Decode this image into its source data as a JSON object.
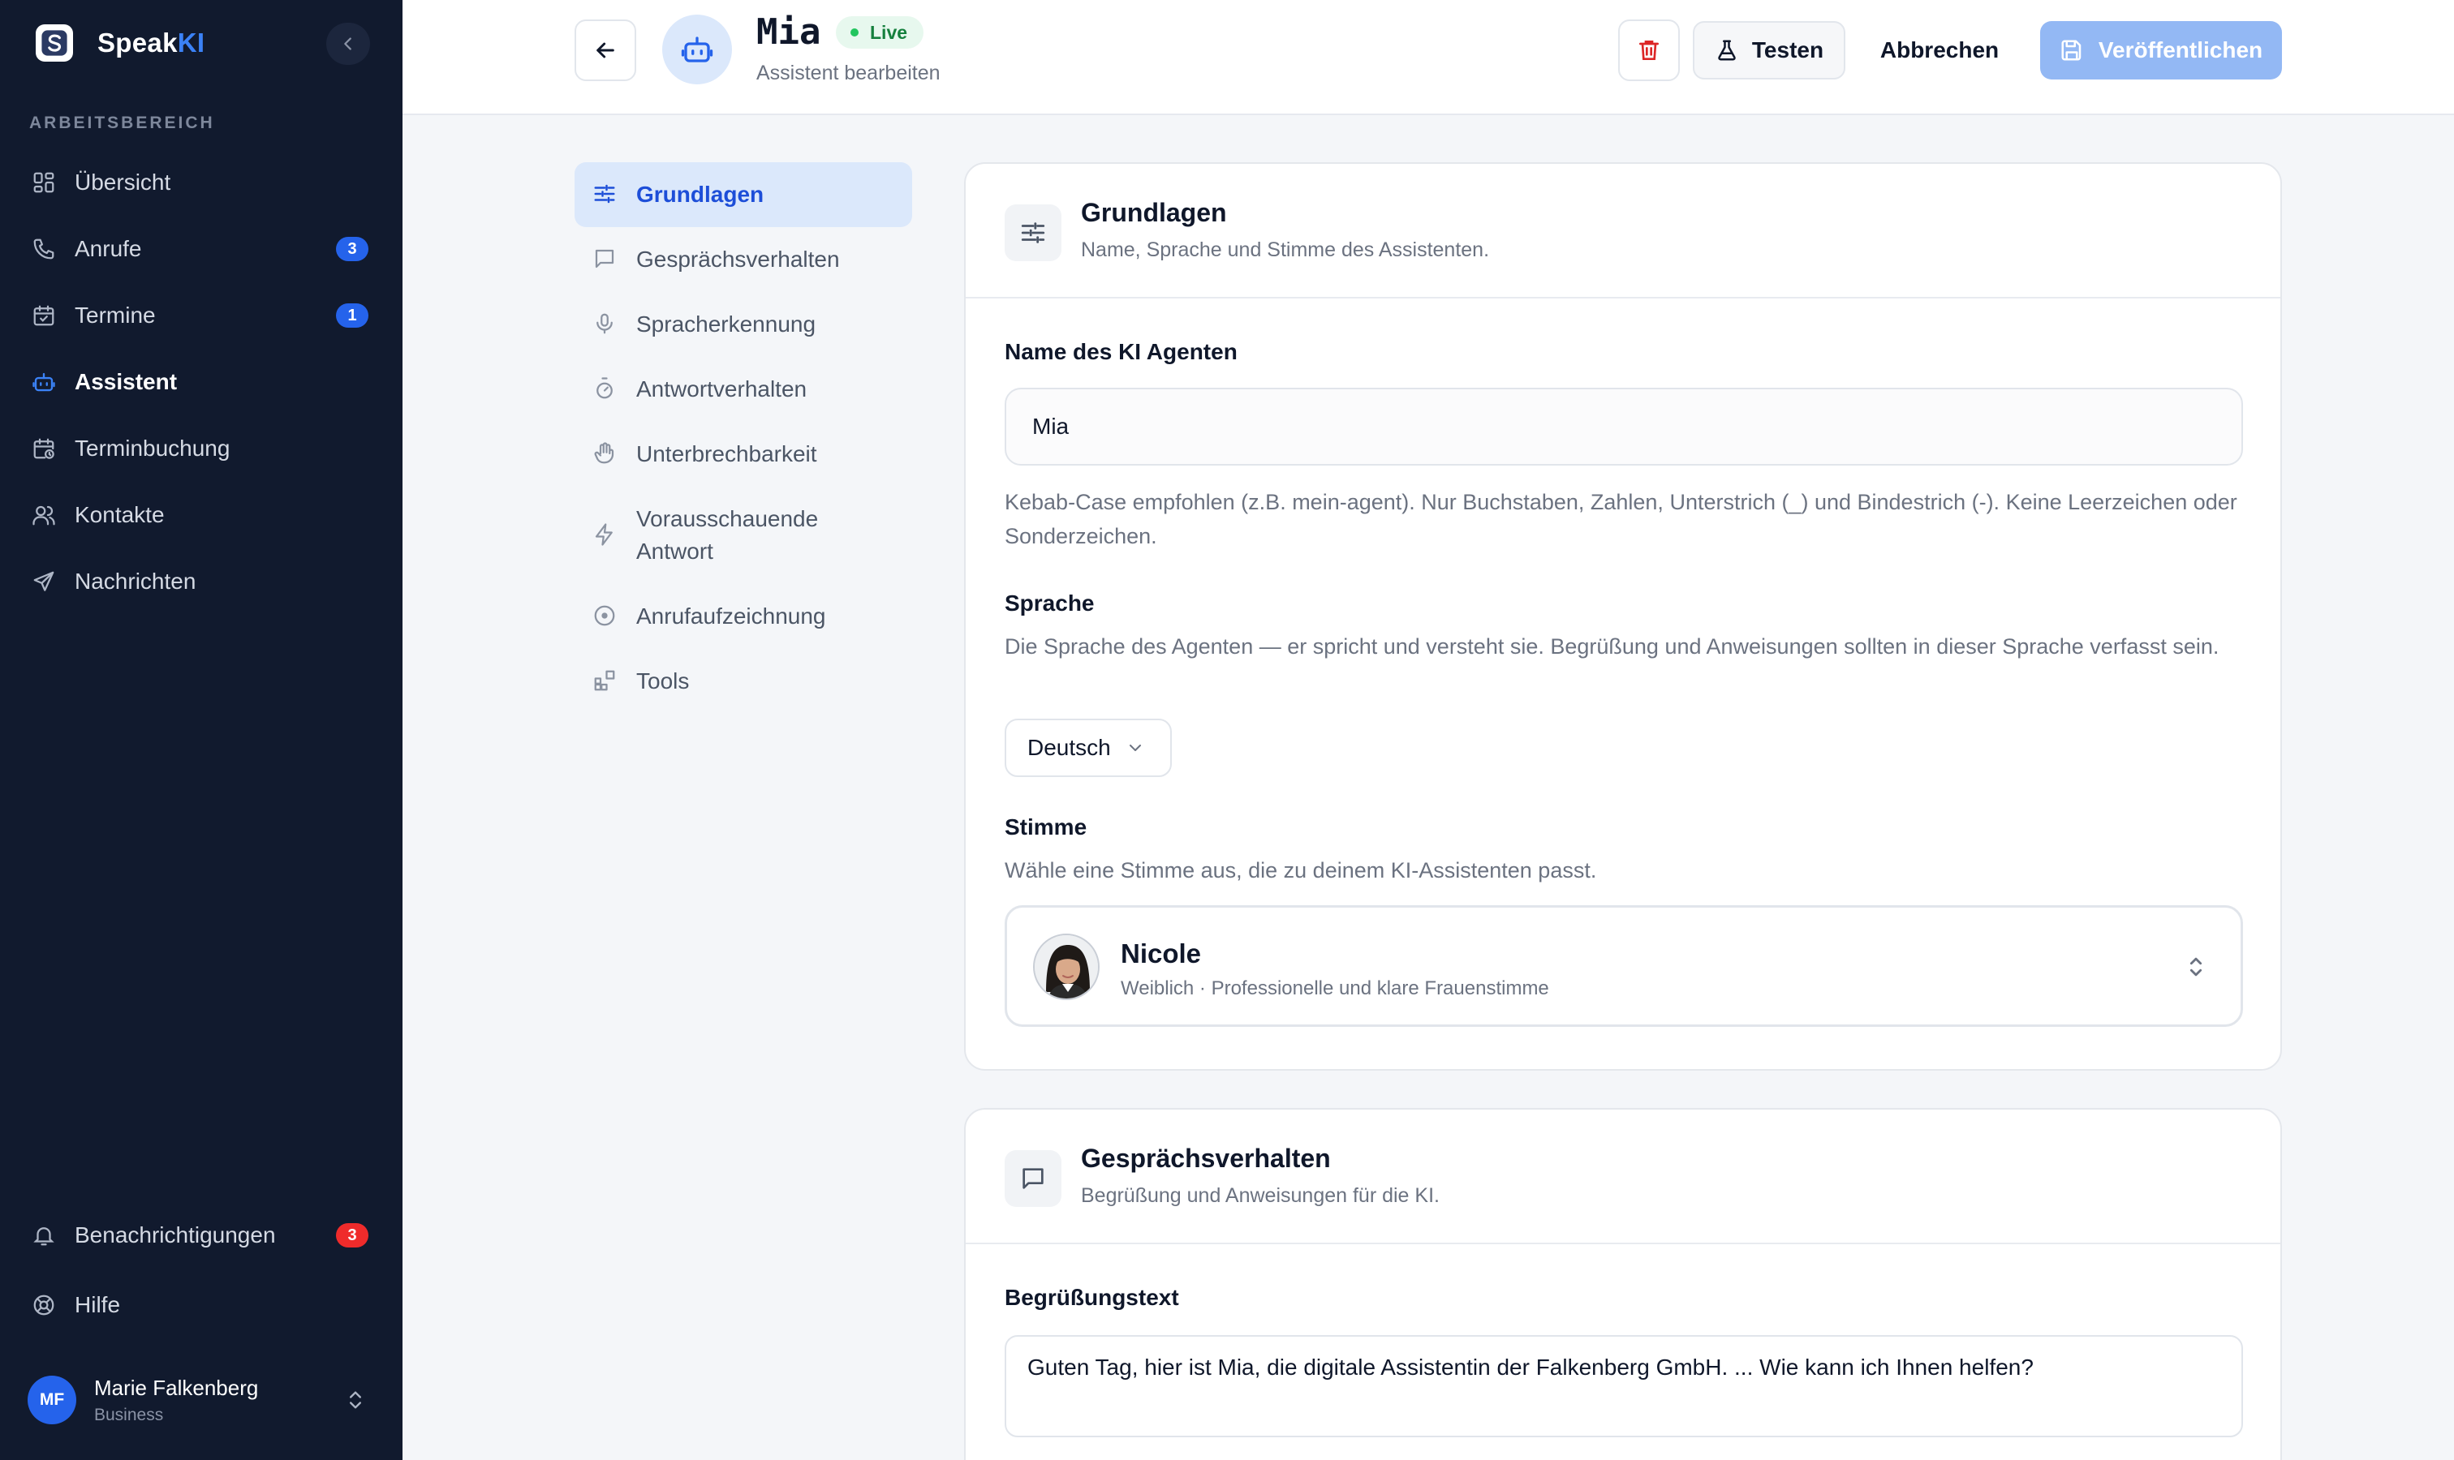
{
  "app": {
    "brand_prefix": "Speak",
    "brand_suffix": "KI"
  },
  "sidebar": {
    "section_label": "ARBEITSBEREICH",
    "items": [
      {
        "label": "Übersicht",
        "icon": "layout-grid-icon"
      },
      {
        "label": "Anrufe",
        "icon": "phone-icon",
        "badge": "3"
      },
      {
        "label": "Termine",
        "icon": "calendar-check-icon",
        "badge": "1"
      },
      {
        "label": "Assistent",
        "icon": "bot-icon",
        "active": true
      },
      {
        "label": "Terminbuchung",
        "icon": "calendar-clock-icon"
      },
      {
        "label": "Kontakte",
        "icon": "users-icon"
      },
      {
        "label": "Nachrichten",
        "icon": "send-icon"
      }
    ],
    "bottom_items": [
      {
        "label": "Benachrichtigungen",
        "icon": "bell-icon",
        "badge": "3"
      },
      {
        "label": "Hilfe",
        "icon": "life-buoy-icon"
      }
    ],
    "user": {
      "initials": "MF",
      "name": "Marie Falkenberg",
      "plan": "Business"
    }
  },
  "header": {
    "assistant_name": "Mia",
    "status": "Live",
    "subtitle": "Assistent bearbeiten",
    "test_label": "Testen",
    "cancel_label": "Abbrechen",
    "publish_label": "Veröffentlichen"
  },
  "subnav": {
    "items": [
      {
        "label": "Grundlagen",
        "icon": "sliders-icon",
        "active": true
      },
      {
        "label": "Gesprächsverhalten",
        "icon": "message-square-icon"
      },
      {
        "label": "Spracherkennung",
        "icon": "mic-icon"
      },
      {
        "label": "Antwortverhalten",
        "icon": "timer-icon"
      },
      {
        "label": "Unterbrechbarkeit",
        "icon": "hand-icon"
      },
      {
        "label": "Vorausschauende Antwort",
        "icon": "zap-icon"
      },
      {
        "label": "Anrufaufzeichnung",
        "icon": "record-icon"
      },
      {
        "label": "Tools",
        "icon": "blocks-icon"
      }
    ]
  },
  "basics": {
    "title": "Grundlagen",
    "subtitle": "Name, Sprache und Stimme des Assistenten.",
    "name_label": "Name des KI Agenten",
    "name_value": "Mia",
    "name_help": "Kebab-Case empfohlen (z.B. mein-agent). Nur Buchstaben, Zahlen, Unterstrich (_) und Bindestrich (-). Keine Leerzeichen oder Sonderzeichen.",
    "language_label": "Sprache",
    "language_help": "Die Sprache des Agenten — er spricht und versteht sie. Begrüßung und Anweisungen sollten in dieser Sprache verfasst sein.",
    "language_value": "Deutsch",
    "voice_label": "Stimme",
    "voice_help": "Wähle eine Stimme aus, die zu deinem KI-Assistenten passt.",
    "voice_name": "Nicole",
    "voice_desc": "Weiblich · Professionelle und klare Frauenstimme"
  },
  "conversation": {
    "title": "Gesprächsverhalten",
    "subtitle": "Begrüßung und Anweisungen für die KI.",
    "greeting_label": "Begrüßungstext",
    "greeting_value": "Guten Tag, hier ist Mia, die digitale Assistentin der Falkenberg GmbH. ... Wie kann ich Ihnen helfen?"
  },
  "colors": {
    "sidebar_bg": "#111a2e",
    "accent": "#2563eb",
    "danger": "#ef2b2b",
    "live": "#15803d"
  }
}
